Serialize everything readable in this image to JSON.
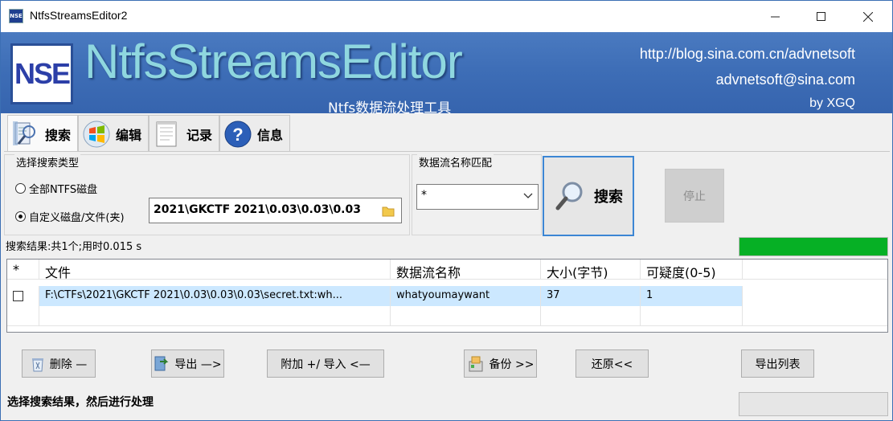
{
  "window": {
    "title": "NtfsStreamsEditor2",
    "app_icon_text": "NSE"
  },
  "banner": {
    "logo_text": "NSE",
    "product_name": "NtfsStreamsEditor",
    "subtitle": "Ntfs数据流处理工具",
    "url": "http://blog.sina.com.cn/advnetsoft",
    "email": "advnetsoft@sina.com",
    "author": "by XGQ"
  },
  "tabs": [
    {
      "label": "搜索",
      "icon": "search-doc-icon"
    },
    {
      "label": "编辑",
      "icon": "windows-orb-icon"
    },
    {
      "label": "记录",
      "icon": "notepad-icon"
    },
    {
      "label": "信息",
      "icon": "help-icon"
    }
  ],
  "search_type": {
    "title": "选择搜索类型",
    "option_all": "全部NTFS磁盘",
    "option_custom": "自定义磁盘/文件(夹)",
    "selected": "自定义磁盘/文件(夹)",
    "path_value": "2021\\GKCTF 2021\\0.03\\0.03\\0.03"
  },
  "stream_match": {
    "title": "数据流名称匹配",
    "value": "*"
  },
  "buttons": {
    "search": "搜索",
    "stop": "停止",
    "delete": "删除 —",
    "export": "导出 —>",
    "append_import": "附加 +/ 导入 <—",
    "backup": "备份 >>",
    "restore": "还原<<",
    "export_list": "导出列表"
  },
  "status": {
    "result": "搜索结果:共1个;用时0.015 s",
    "progress": 1.0,
    "progress_color": "#06b025",
    "bottom": "选择搜索结果，然后进行处理"
  },
  "table": {
    "headers": [
      "*",
      "文件",
      "数据流名称",
      "大小(字节)",
      "可疑度(0-5)"
    ],
    "rows": [
      {
        "checked": false,
        "file": "F:\\CTFs\\2021\\GKCTF 2021\\0.03\\0.03\\0.03\\secret.txt:wh...",
        "stream": "whatyoumaywant",
        "size": "37",
        "suspicion": "1"
      }
    ]
  }
}
